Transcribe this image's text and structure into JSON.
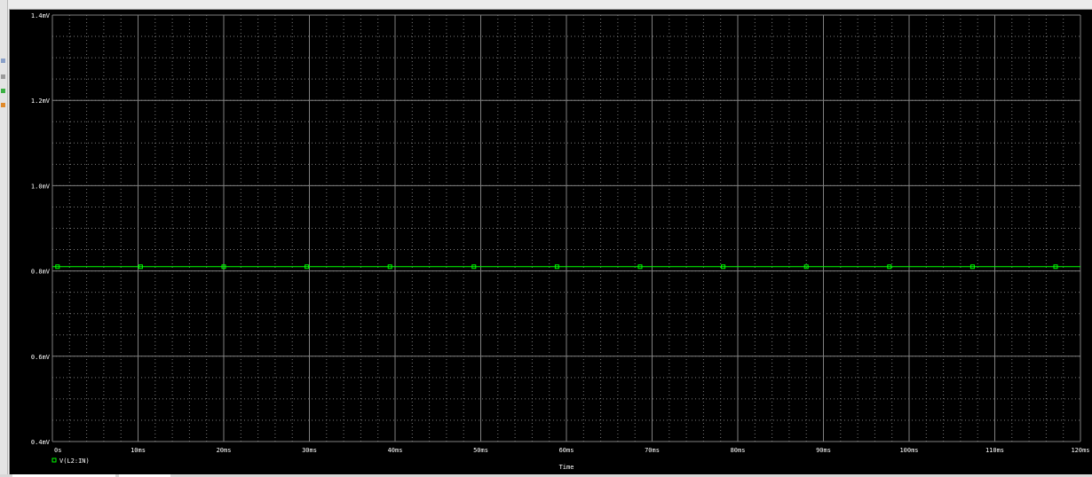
{
  "colors": {
    "background": "#000000",
    "grid_major": "#808080",
    "grid_minor": "#7a7a7a",
    "axis_text": "#ffffff",
    "trace": "#00ff00"
  },
  "icons": {
    "toolbar": [
      "zoom-icon",
      "cursor-icon",
      "marker-icon",
      "trace-icon"
    ],
    "legend_marker": "square-marker-icon"
  },
  "chart_data": {
    "type": "line",
    "title": "",
    "xlabel": "Time",
    "ylabel": "",
    "xlim": [
      0,
      120
    ],
    "ylim": [
      0.4,
      1.4
    ],
    "x_unit": "ms",
    "y_unit": "mV",
    "x_ticks": [
      0,
      10,
      20,
      30,
      40,
      50,
      60,
      70,
      80,
      90,
      100,
      110,
      120
    ],
    "x_tick_labels": [
      "0s",
      "10ms",
      "20ms",
      "30ms",
      "40ms",
      "50ms",
      "60ms",
      "70ms",
      "80ms",
      "90ms",
      "100ms",
      "110ms",
      "120ms"
    ],
    "y_ticks": [
      0.4,
      0.6,
      0.8,
      1.0,
      1.2,
      1.4
    ],
    "y_tick_labels": [
      "0.4mV",
      "0.6mV",
      "0.8mV",
      "1.0mV",
      "1.2mV",
      "1.4mV"
    ],
    "grid": true,
    "legend_position": "bottom-left",
    "series": [
      {
        "name": "V(L2:IN)",
        "color": "#00ff00",
        "x": [
          0,
          120
        ],
        "y": [
          0.81,
          0.81
        ],
        "marker_x": [
          0.6,
          10.3,
          20.0,
          29.7,
          39.4,
          49.2,
          58.9,
          68.6,
          78.3,
          88.0,
          97.7,
          107.4,
          117.1
        ]
      }
    ]
  }
}
